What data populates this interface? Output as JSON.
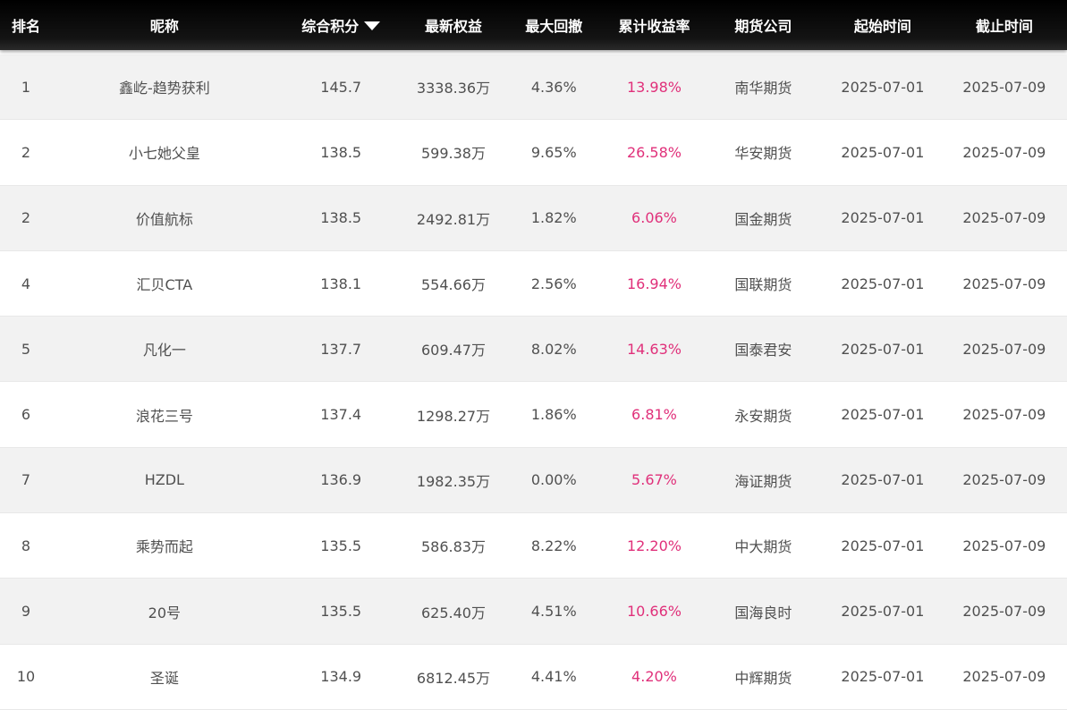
{
  "header": {
    "rank": "排名",
    "nickname": "昵称",
    "score": "综合积分",
    "equity": "最新权益",
    "drawdown": "最大回撤",
    "return": "累计收益率",
    "company": "期货公司",
    "start": "起始时间",
    "end": "截止时间",
    "sort_icon": "caret-down-icon"
  },
  "colors": {
    "header_bg": "#000000",
    "return_text": "#e0307a",
    "row_alt": "#f2f2f2"
  },
  "rows": [
    {
      "rank": "1",
      "nickname": "鑫屹-趋势获利",
      "score": "145.7",
      "equity": "3338.36万",
      "drawdown": "4.36%",
      "return": "13.98%",
      "company": "南华期货",
      "start": "2025-07-01",
      "end": "2025-07-09"
    },
    {
      "rank": "2",
      "nickname": "小七她父皇",
      "score": "138.5",
      "equity": "599.38万",
      "drawdown": "9.65%",
      "return": "26.58%",
      "company": "华安期货",
      "start": "2025-07-01",
      "end": "2025-07-09"
    },
    {
      "rank": "2",
      "nickname": "价值航标",
      "score": "138.5",
      "equity": "2492.81万",
      "drawdown": "1.82%",
      "return": "6.06%",
      "company": "国金期货",
      "start": "2025-07-01",
      "end": "2025-07-09"
    },
    {
      "rank": "4",
      "nickname": "汇贝CTA",
      "score": "138.1",
      "equity": "554.66万",
      "drawdown": "2.56%",
      "return": "16.94%",
      "company": "国联期货",
      "start": "2025-07-01",
      "end": "2025-07-09"
    },
    {
      "rank": "5",
      "nickname": "凡化一",
      "score": "137.7",
      "equity": "609.47万",
      "drawdown": "8.02%",
      "return": "14.63%",
      "company": "国泰君安",
      "start": "2025-07-01",
      "end": "2025-07-09"
    },
    {
      "rank": "6",
      "nickname": "浪花三号",
      "score": "137.4",
      "equity": "1298.27万",
      "drawdown": "1.86%",
      "return": "6.81%",
      "company": "永安期货",
      "start": "2025-07-01",
      "end": "2025-07-09"
    },
    {
      "rank": "7",
      "nickname": "HZDL",
      "score": "136.9",
      "equity": "1982.35万",
      "drawdown": "0.00%",
      "return": "5.67%",
      "company": "海证期货",
      "start": "2025-07-01",
      "end": "2025-07-09"
    },
    {
      "rank": "8",
      "nickname": "乘势而起",
      "score": "135.5",
      "equity": "586.83万",
      "drawdown": "8.22%",
      "return": "12.20%",
      "company": "中大期货",
      "start": "2025-07-01",
      "end": "2025-07-09"
    },
    {
      "rank": "9",
      "nickname": "20号",
      "score": "135.5",
      "equity": "625.40万",
      "drawdown": "4.51%",
      "return": "10.66%",
      "company": "国海良时",
      "start": "2025-07-01",
      "end": "2025-07-09"
    },
    {
      "rank": "10",
      "nickname": "圣诞",
      "score": "134.9",
      "equity": "6812.45万",
      "drawdown": "4.41%",
      "return": "4.20%",
      "company": "中辉期货",
      "start": "2025-07-01",
      "end": "2025-07-09"
    }
  ]
}
